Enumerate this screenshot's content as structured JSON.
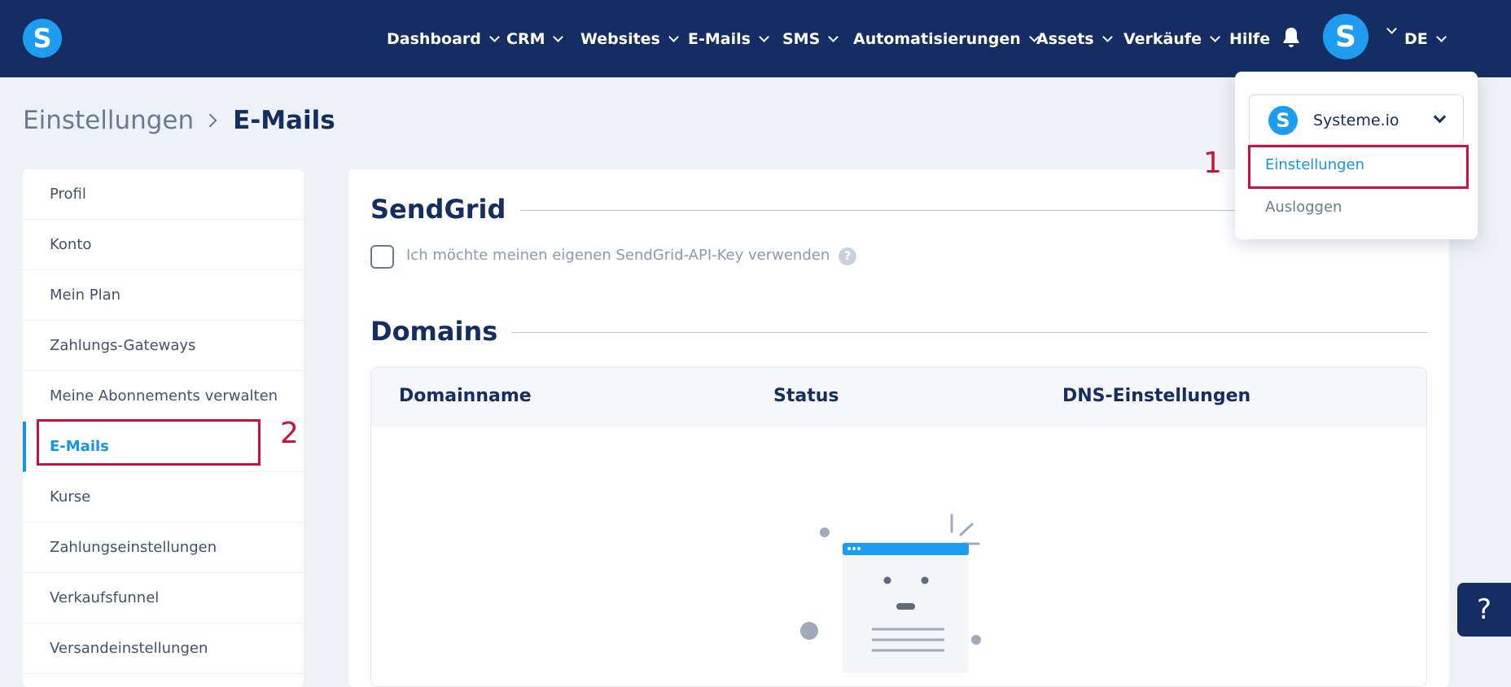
{
  "header": {
    "logo_letter": "S",
    "nav": [
      {
        "label": "Dashboard",
        "dropdown": true
      },
      {
        "label": "CRM",
        "dropdown": true
      },
      {
        "label": "Websites",
        "dropdown": true
      },
      {
        "label": "E-Mails",
        "dropdown": true
      },
      {
        "label": "SMS",
        "dropdown": true
      },
      {
        "label": "Automatisierungen",
        "dropdown": true
      },
      {
        "label": "Assets",
        "dropdown": true
      },
      {
        "label": "Verkäufe",
        "dropdown": true
      },
      {
        "label": "Hilfe",
        "dropdown": false
      }
    ],
    "avatar_letter": "S",
    "language": "DE",
    "icons": [
      "bell-icon",
      "chevron-down-icon"
    ]
  },
  "breadcrumb": {
    "parent": "Einstellungen",
    "current": "E-Mails"
  },
  "sidebar": {
    "items": [
      {
        "label": "Profil",
        "active": false
      },
      {
        "label": "Konto",
        "active": false
      },
      {
        "label": "Mein Plan",
        "active": false
      },
      {
        "label": "Zahlungs-Gateways",
        "active": false
      },
      {
        "label": "Meine Abonnements verwalten",
        "active": false
      },
      {
        "label": "E-Mails",
        "active": true
      },
      {
        "label": "Kurse",
        "active": false
      },
      {
        "label": "Zahlungseinstellungen",
        "active": false
      },
      {
        "label": "Verkaufsfunnel",
        "active": false
      },
      {
        "label": "Versandeinstellungen",
        "active": false
      }
    ]
  },
  "main": {
    "sendgrid": {
      "title": "SendGrid",
      "checkbox_label": "Ich möchte meinen eigenen SendGrid-API-Key verwenden",
      "checked": false,
      "help_glyph": "?"
    },
    "domains": {
      "title": "Domains",
      "columns": [
        "Domainname",
        "Status",
        "DNS-Einstellungen"
      ]
    }
  },
  "dropdown": {
    "account_name": "Systeme.io",
    "account_letter": "S",
    "items": [
      "Einstellungen",
      "Ausloggen"
    ]
  },
  "annotations": {
    "step1": "1",
    "step2": "2"
  },
  "help_button": "?",
  "colors": {
    "nav_bg": "#142d63",
    "brand_blue": "#1e9cf0",
    "active_blue": "#1593e6",
    "annotation_red": "#c8143c",
    "page_bg": "#eef1f5"
  }
}
